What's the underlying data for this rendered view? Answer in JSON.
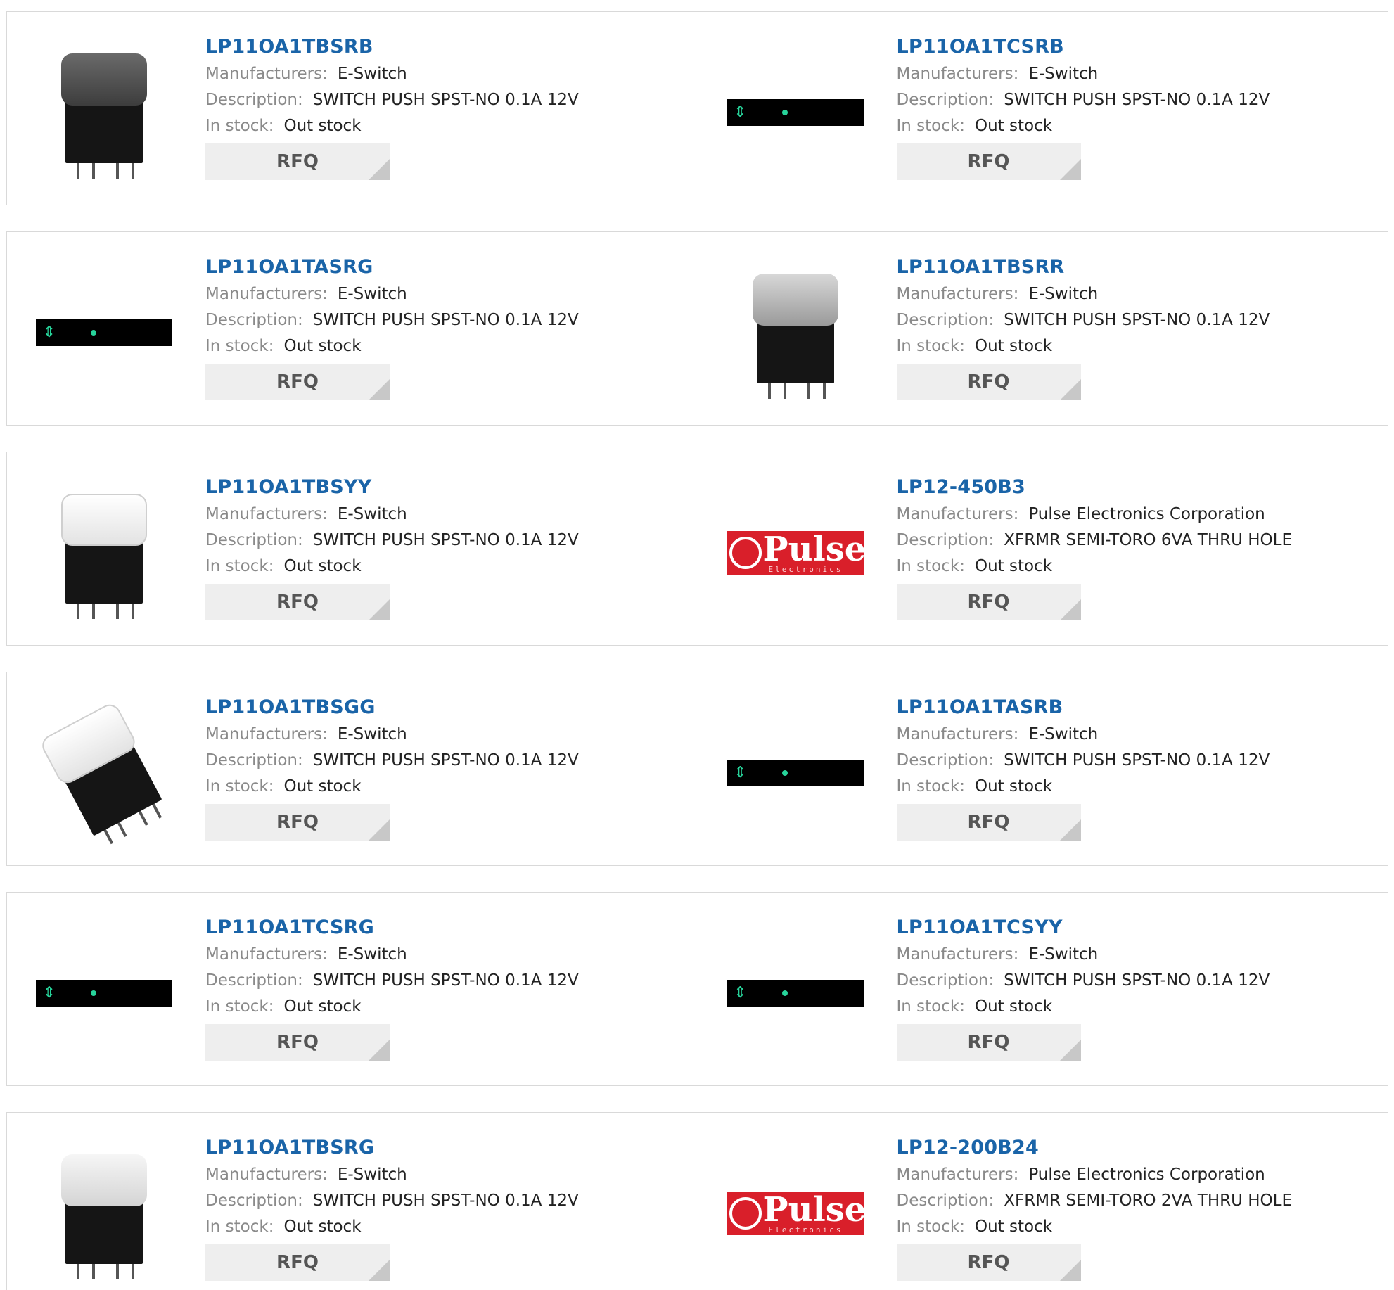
{
  "labels": {
    "manufacturers": "Manufacturers:",
    "description": "Description:",
    "in_stock": "In stock:",
    "rfq": "RFQ"
  },
  "products": [
    {
      "part": "LP11OA1TBSRB",
      "manufacturer": "E-Switch",
      "description": "SWITCH PUSH SPST-NO 0.1A 12V",
      "stock": "Out stock",
      "thumb": "switch-dark-cap"
    },
    {
      "part": "LP11OA1TCSRB",
      "manufacturer": "E-Switch",
      "description": "SWITCH PUSH SPST-NO 0.1A 12V",
      "stock": "Out stock",
      "thumb": "lcd-placeholder"
    },
    {
      "part": "LP11OA1TASRG",
      "manufacturer": "E-Switch",
      "description": "SWITCH PUSH SPST-NO 0.1A 12V",
      "stock": "Out stock",
      "thumb": "lcd-placeholder"
    },
    {
      "part": "LP11OA1TBSRR",
      "manufacturer": "E-Switch",
      "description": "SWITCH PUSH SPST-NO 0.1A 12V",
      "stock": "Out stock",
      "thumb": "switch-grey-cap"
    },
    {
      "part": "LP11OA1TBSYY",
      "manufacturer": "E-Switch",
      "description": "SWITCH PUSH SPST-NO 0.1A 12V",
      "stock": "Out stock",
      "thumb": "switch-clear-cap"
    },
    {
      "part": "LP12-450B3",
      "manufacturer": "Pulse Electronics Corporation",
      "description": "XFRMR SEMI-TORO 6VA THRU HOLE",
      "stock": "Out stock",
      "thumb": "pulse-logo"
    },
    {
      "part": "LP11OA1TBSGG",
      "manufacturer": "E-Switch",
      "description": "SWITCH PUSH SPST-NO 0.1A 12V",
      "stock": "Out stock",
      "thumb": "switch-clear-tilted"
    },
    {
      "part": "LP11OA1TASRB",
      "manufacturer": "E-Switch",
      "description": "SWITCH PUSH SPST-NO 0.1A 12V",
      "stock": "Out stock",
      "thumb": "lcd-placeholder"
    },
    {
      "part": "LP11OA1TCSRG",
      "manufacturer": "E-Switch",
      "description": "SWITCH PUSH SPST-NO 0.1A 12V",
      "stock": "Out stock",
      "thumb": "lcd-placeholder"
    },
    {
      "part": "LP11OA1TCSYY",
      "manufacturer": "E-Switch",
      "description": "SWITCH PUSH SPST-NO 0.1A 12V",
      "stock": "Out stock",
      "thumb": "lcd-placeholder"
    },
    {
      "part": "LP11OA1TBSRG",
      "manufacturer": "E-Switch",
      "description": "SWITCH PUSH SPST-NO 0.1A 12V",
      "stock": "Out stock",
      "thumb": "switch-frost-cap"
    },
    {
      "part": "LP12-200B24",
      "manufacturer": "Pulse Electronics Corporation",
      "description": "XFRMR SEMI-TORO 2VA THRU HOLE",
      "stock": "Out stock",
      "thumb": "pulse-logo"
    }
  ],
  "pulse_logo": {
    "text": "Pulse",
    "sub": "Electronics"
  },
  "colors": {
    "part_link": "#1a64a8",
    "label": "#8a8a8a",
    "rfq_bg": "#eeeeee",
    "border": "#d9d9d9"
  }
}
